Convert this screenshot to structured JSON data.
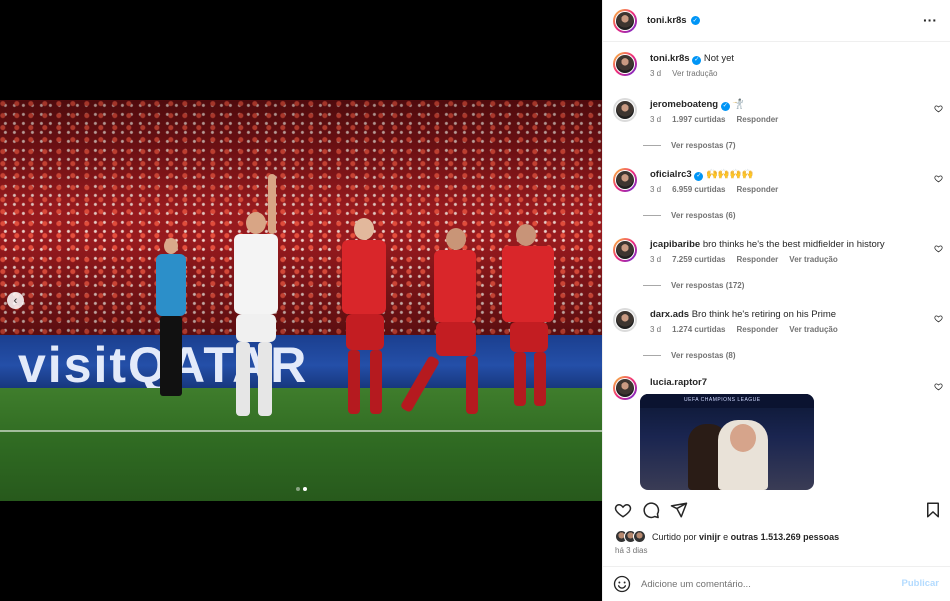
{
  "post": {
    "author": "toni.kr8s",
    "more_icon": "more-icon",
    "prev_icon": "chevron-left-icon"
  },
  "caption": {
    "user": "toni.kr8s",
    "text": "Not yet",
    "time": "3 d",
    "translate": "Ver tradução"
  },
  "media": {
    "ad_text": "visitQATAR",
    "slide_count": 2,
    "active_slide": 2
  },
  "comments": [
    {
      "user": "jeromeboateng",
      "verified": true,
      "text": "🤺",
      "time": "3 d",
      "likes": "1.997 curtidas",
      "reply": "Responder",
      "translate": "",
      "replies": "Ver respostas (7)"
    },
    {
      "user": "oficialrc3",
      "verified": true,
      "text": "🙌🙌🙌🙌",
      "time": "3 d",
      "likes": "6.959 curtidas",
      "reply": "Responder",
      "translate": "",
      "replies": "Ver respostas (6)"
    },
    {
      "user": "jcapibaribe",
      "verified": false,
      "text": "bro thinks he's the best midfielder in history",
      "time": "3 d",
      "likes": "7.259 curtidas",
      "reply": "Responder",
      "translate": "Ver tradução",
      "replies": "Ver respostas (172)"
    },
    {
      "user": "darx.ads",
      "verified": false,
      "text": "Bro think he's retiring on his Prime",
      "time": "3 d",
      "likes": "1.274 curtidas",
      "reply": "Responder",
      "translate": "Ver tradução",
      "replies": "Ver respostas (8)"
    },
    {
      "user": "lucia.raptor7",
      "verified": false,
      "text": "",
      "image_caption": "UEFA CHAMPIONS LEAGUE"
    }
  ],
  "actions": {
    "like_icon": "heart-icon",
    "comment_icon": "comment-icon",
    "share_icon": "send-icon",
    "save_icon": "bookmark-icon"
  },
  "likes": {
    "prefix": "Curtido por",
    "user": "vinijr",
    "connector": "e",
    "others": "outras 1.513.269 pessoas"
  },
  "posted": "há 3 dias",
  "add_comment": {
    "placeholder": "Adicione um comentário...",
    "publish": "Publicar",
    "emoji_icon": "emoji-icon"
  }
}
